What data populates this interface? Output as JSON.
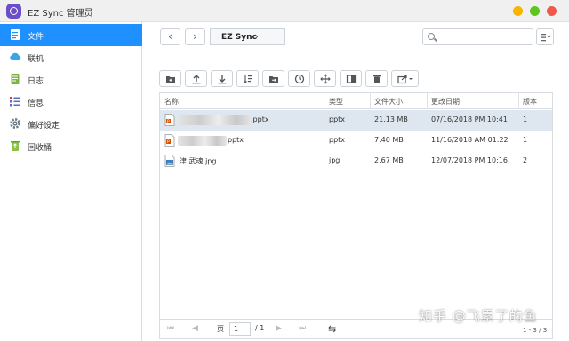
{
  "window": {
    "title": "EZ Sync 管理员",
    "buttons": [
      {
        "name": "minimize",
        "color": "#f7b500"
      },
      {
        "name": "maximize",
        "color": "#5cc51e"
      },
      {
        "name": "close",
        "color": "#f0584a"
      }
    ]
  },
  "sidebar": {
    "items": [
      {
        "label": "文件",
        "icon": "file-icon",
        "active": true
      },
      {
        "label": "联机",
        "icon": "cloud-icon",
        "active": false
      },
      {
        "label": "日志",
        "icon": "log-icon",
        "active": false
      },
      {
        "label": "信息",
        "icon": "info-icon",
        "active": false
      },
      {
        "label": "偏好设定",
        "icon": "gear-icon",
        "active": false
      },
      {
        "label": "回收桶",
        "icon": "recycle-bin-icon",
        "active": false
      }
    ]
  },
  "toolbar": {
    "back": "‹",
    "forward": "›",
    "path": "EZ Sync",
    "path_arrow": "›",
    "search_placeholder": ""
  },
  "actions": [
    "new-folder-icon",
    "upload-icon",
    "download-icon",
    "sort-az-icon",
    "folder-move-icon",
    "history-icon",
    "move-icon",
    "columns-icon",
    "delete-icon",
    "share-icon"
  ],
  "table": {
    "headers": [
      "名称",
      "类型",
      "文件大小",
      "更改日期",
      "版本"
    ],
    "rows": [
      {
        "name": ".pptx",
        "type": "pptx",
        "size": "21.13 MB",
        "date": "07/16/2018 PM 10:41",
        "version": "1",
        "icon": "pptx-icon",
        "blurred": true,
        "selected": true
      },
      {
        "name": "pptx",
        "type": "pptx",
        "size": "7.40 MB",
        "date": "11/16/2018 AM 01:22",
        "version": "1",
        "icon": "pptx-icon",
        "blurred": true,
        "selected": false
      },
      {
        "name": "津 武魂.jpg",
        "type": "jpg",
        "size": "2.67 MB",
        "date": "12/07/2018 PM 10:16",
        "version": "2",
        "icon": "jpg-icon",
        "blurred": false,
        "selected": false
      }
    ]
  },
  "pager": {
    "page_label": "页",
    "page_value": "1",
    "total_pages": "/ 1",
    "count": "1 - 3 / 3"
  },
  "watermark": "知乎 @飞累了的鱼",
  "colors": {
    "accent": "#1e90ff",
    "selected_row": "#dee6ef",
    "app_icon": "#6c4fc7"
  }
}
